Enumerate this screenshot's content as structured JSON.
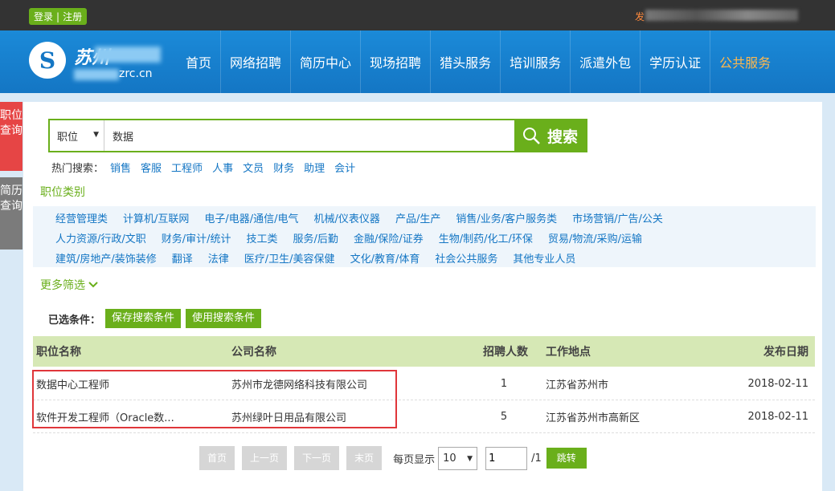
{
  "topbar": {
    "login": "登录",
    "separator": "|",
    "register": "注册",
    "right_text": "发"
  },
  "header": {
    "logo_glyph": "S",
    "logo_text": "苏州",
    "logo_sub": "zrc.cn",
    "nav": [
      {
        "label": "首页",
        "active": false
      },
      {
        "label": "网络招聘",
        "active": false
      },
      {
        "label": "简历中心",
        "active": false
      },
      {
        "label": "现场招聘",
        "active": false
      },
      {
        "label": "猎头服务",
        "active": false
      },
      {
        "label": "培训服务",
        "active": false
      },
      {
        "label": "派遣外包",
        "active": false
      },
      {
        "label": "学历认证",
        "active": false
      },
      {
        "label": "公共服务",
        "active": true
      }
    ]
  },
  "side_tabs": {
    "job": "职位查询",
    "resume": "简历查询"
  },
  "search": {
    "type": "职位",
    "query": "数据",
    "button": "搜索"
  },
  "hot": {
    "label": "热门搜索：",
    "keywords": [
      "销售",
      "客服",
      "工程师",
      "人事",
      "文员",
      "财务",
      "助理",
      "会计"
    ]
  },
  "categories": {
    "title": "职位类别",
    "rows": [
      [
        "经营管理类",
        "计算机/互联网",
        "电子/电器/通信/电气",
        "机械/仪表仪器",
        "产品/生产",
        "销售/业务/客户服务类",
        "市场营销/广告/公关"
      ],
      [
        "人力资源/行政/文职",
        "财务/审计/统计",
        "技工类",
        "服务/后勤",
        "金融/保险/证券",
        "生物/制药/化工/环保",
        "贸易/物流/采购/运输"
      ],
      [
        "建筑/房地产/装饰装修",
        "翻译",
        "法律",
        "医疗/卫生/美容保健",
        "文化/教育/体育",
        "社会公共服务",
        "其他专业人员"
      ]
    ],
    "more": "更多筛选"
  },
  "selected": {
    "label": "已选条件：",
    "save": "保存搜索条件",
    "use": "使用搜索条件"
  },
  "table": {
    "headers": {
      "name": "职位名称",
      "company": "公司名称",
      "count": "招聘人数",
      "location": "工作地点",
      "date": "发布日期"
    },
    "rows": [
      {
        "name": "数据中心工程师",
        "company": "苏州市龙德网络科技有限公司",
        "count": "1",
        "location": "江苏省苏州市",
        "date": "2018-02-11"
      },
      {
        "name": "软件开发工程师（Oracle数...",
        "company": "苏州绿叶日用品有限公司",
        "count": "5",
        "location": "江苏省苏州市高新区",
        "date": "2018-02-11"
      }
    ]
  },
  "pager": {
    "first": "首页",
    "prev": "上一页",
    "next": "下一页",
    "last": "末页",
    "per_page_label": "每页显示",
    "per_page": "10",
    "page": "1",
    "total": "/1",
    "jump": "跳转"
  }
}
